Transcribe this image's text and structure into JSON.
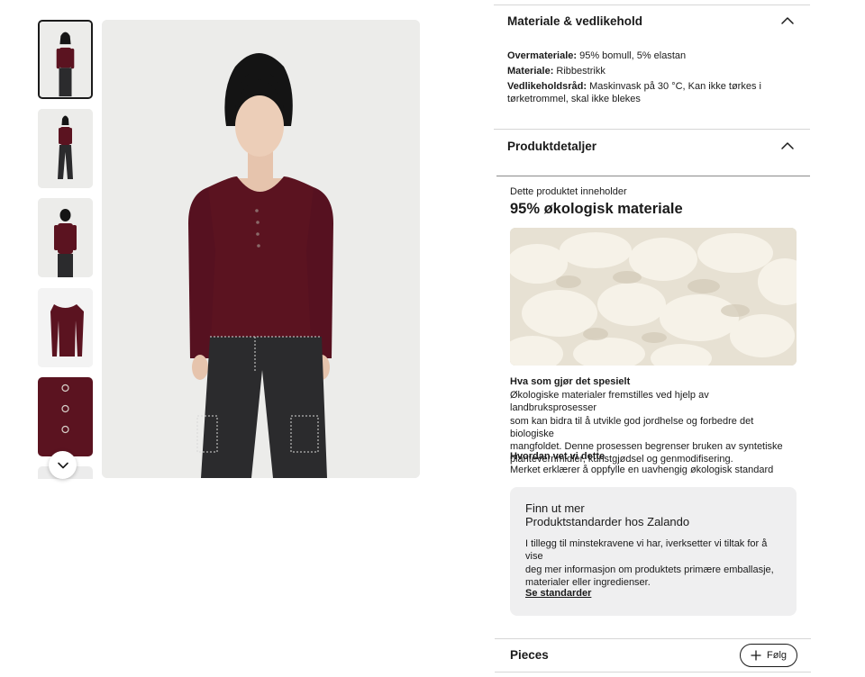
{
  "materials_section": {
    "title": "Materiale & vedlikehold",
    "rows": [
      {
        "label": "Overmateriale:",
        "value": "95% bomull, 5% elastan"
      },
      {
        "label": "Materiale:",
        "value": "Ribbestrikk"
      },
      {
        "label": "Vedlikeholdsråd:",
        "value": "Maskinvask på 30 °C, Kan ikke tørkes i"
      },
      {
        "label": "",
        "value": "tørketrommel, skal ikke blekes"
      }
    ]
  },
  "details_section": {
    "title": "Produktdetaljer",
    "intro": "Dette produktet inneholder",
    "headline": "95% økologisk materiale"
  },
  "special": {
    "title": "Hva som gjør det spesielt",
    "lines": [
      "Økologiske materialer fremstilles ved hjelp av landbruksprosesser",
      "som kan bidra til å utvikle god jordhelse og forbedre det biologiske",
      "mangfoldet. Denne prosessen begrenser bruken av syntetiske",
      "plantevernmidler, kunstgjødsel og genmodifisering."
    ]
  },
  "how": {
    "title": "Hvordan vet vi dette",
    "text": "Merket erklærer å oppfylle en uavhengig økologisk standard"
  },
  "info_box": {
    "title_line1": "Finn ut mer",
    "title_line2": "Produktstandarder hos Zalando",
    "lines": [
      "I tillegg til minstekravene vi har, iverksetter vi tiltak for å vise",
      "deg mer informasjon om produktets primære emballasje,",
      "materialer eller ingredienser."
    ],
    "link": "Se standarder"
  },
  "brand": {
    "name": "Pieces",
    "follow_label": "Følg"
  },
  "colors": {
    "garment": "#5b1320",
    "pants": "#2b2b2d",
    "box_bg": "#efeff0"
  }
}
